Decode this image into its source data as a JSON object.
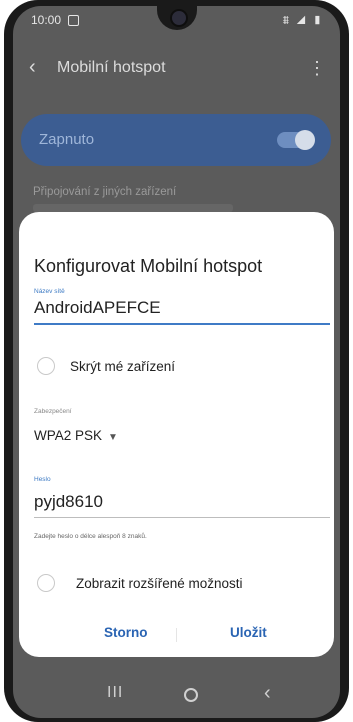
{
  "status_bar": {
    "time": "10:00",
    "system_icons": "⩩ ◢ ▮"
  },
  "app_bar": {
    "title": "Mobilní hotspot",
    "back_icon": "‹",
    "more_icon": "⋮"
  },
  "toggle_card": {
    "label": "Zapnuto",
    "state": "on"
  },
  "background_section": {
    "label": "Připojování z jiných zařízení"
  },
  "dialog": {
    "title": "Konfigurovat Mobilní hotspot",
    "network_name_label": "Název sítě",
    "network_name_value": "AndroidAPEFCE",
    "hide_device_label": "Skrýt mé zařízení",
    "security_label": "Zabezpečení",
    "security_value": "WPA2 PSK",
    "dropdown_icon": "▼",
    "password_label": "Heslo",
    "password_value": "pyjd8610",
    "password_hint": "Zadejte heslo o délce alespoň 8 znaků.",
    "advanced_options_label": "Zobrazit rozšířené možnosti",
    "cancel_label": "Storno",
    "save_label": "Uložit"
  },
  "nav_bar": {
    "recent_icon": "III",
    "back_icon": "‹"
  },
  "colors": {
    "accent": "#3e7bc4",
    "button_text": "#2a64b3",
    "toggle_card": "#3c5d92"
  }
}
